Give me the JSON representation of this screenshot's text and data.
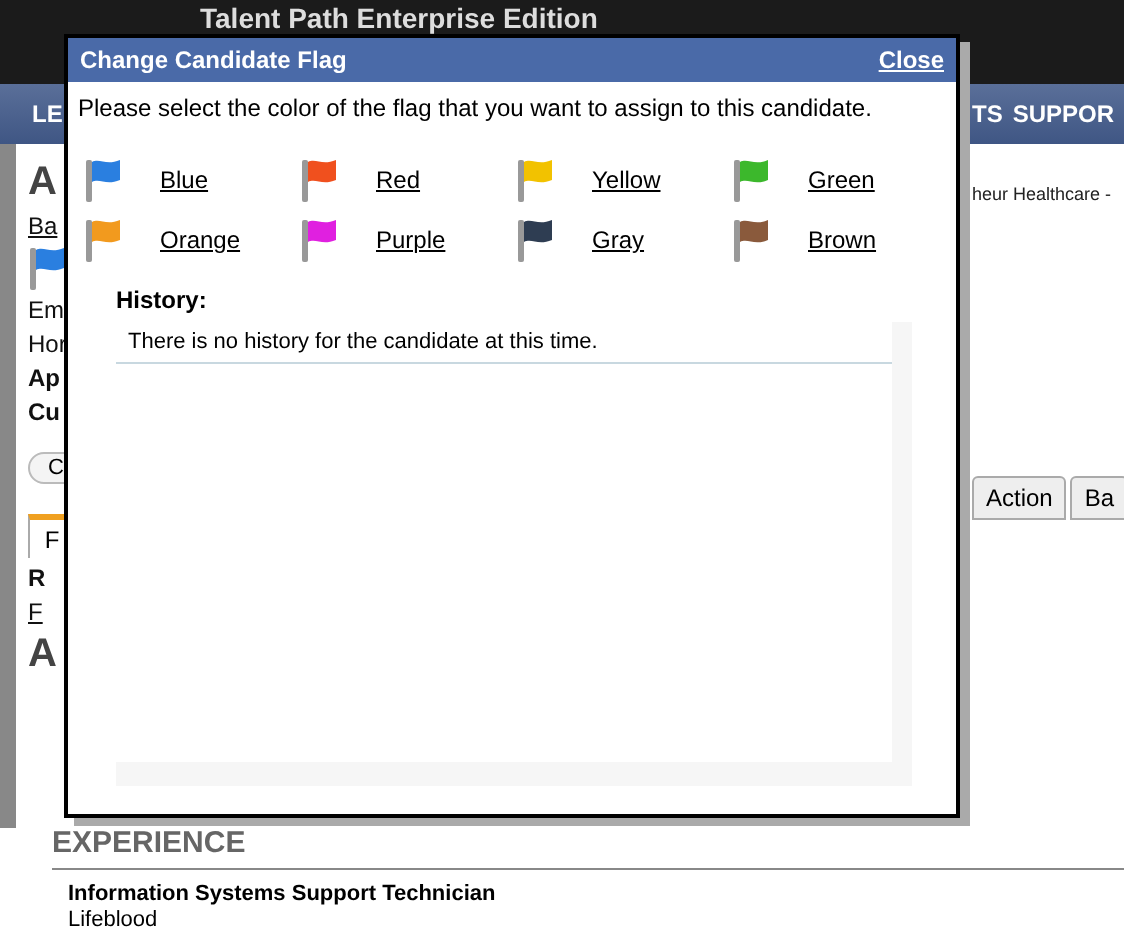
{
  "app_header": {
    "title": "Talent Path Enterprise Edition"
  },
  "nav": {
    "left": "LE",
    "right": [
      "TS",
      "SUPPOR"
    ]
  },
  "left_fragments": [
    {
      "kind": "heading",
      "text": "A"
    },
    {
      "kind": "link",
      "text": "Ba"
    },
    {
      "kind": "flag",
      "color": "#2a7fe0"
    },
    {
      "kind": "text",
      "text": "Em"
    },
    {
      "kind": "text",
      "text": "Hor"
    },
    {
      "kind": "bold",
      "text": "Ap"
    },
    {
      "kind": "bold",
      "text": "Cu"
    },
    {
      "kind": "button",
      "text": "C"
    },
    {
      "kind": "tab",
      "text": "F",
      "selected": true
    },
    {
      "kind": "bold",
      "text": "R"
    },
    {
      "kind": "link",
      "text": "F"
    },
    {
      "kind": "heading",
      "text": "A"
    }
  ],
  "breadcrumb": "heur Healthcare -",
  "tabs": [
    {
      "label": "Action",
      "selected": false
    },
    {
      "label": "Ba",
      "selected": false
    }
  ],
  "section": {
    "title": "EXPERIENCE",
    "job_title": "Information Systems Support Technician",
    "employer": "Lifeblood"
  },
  "dialog": {
    "title": "Change Candidate Flag",
    "close": "Close",
    "prompt": "Please select the color of the flag that you want to assign to this candidate.",
    "flags": [
      {
        "label": "Blue",
        "color": "#2a7fe0"
      },
      {
        "label": "Red",
        "color": "#f0501e"
      },
      {
        "label": "Yellow",
        "color": "#f2c200"
      },
      {
        "label": "Green",
        "color": "#3cb82c"
      },
      {
        "label": "Orange",
        "color": "#f29a1e"
      },
      {
        "label": "Purple",
        "color": "#e020e0"
      },
      {
        "label": "Gray",
        "color": "#2e3d52"
      },
      {
        "label": "Brown",
        "color": "#8a5a3c"
      }
    ],
    "history_label": "History:",
    "history": [
      "There is no history for the candidate at this time."
    ]
  }
}
